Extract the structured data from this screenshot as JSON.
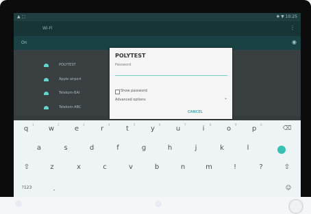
{
  "statusbar": {
    "left": "▲ ⬚",
    "right": "✱ ▼ 10:25"
  },
  "appbar": {
    "title": "Wi‑Fi",
    "more_icon": "⋮"
  },
  "toggle": {
    "label": "On",
    "switch_icon": "◉"
  },
  "networks": [
    {
      "name": "POLYTEST"
    },
    {
      "name": "Apple airport"
    },
    {
      "name": "Telekom-BAI"
    },
    {
      "name": "Telekom-ABC"
    }
  ],
  "dialog": {
    "title": "POLYTEST",
    "password_hint": "Password",
    "show_password": "Show password",
    "advanced": "Advanced options",
    "dropdown_icon": "⌄",
    "cancel": "CANCEL"
  },
  "keyboard": {
    "row1": [
      "q",
      "w",
      "e",
      "r",
      "t",
      "y",
      "u",
      "i",
      "o",
      "p",
      "⌫"
    ],
    "row1_hints": [
      "1",
      "2",
      "3",
      "4",
      "5",
      "6",
      "7",
      "8",
      "9",
      "0"
    ],
    "row2": [
      "a",
      "s",
      "d",
      "f",
      "g",
      "h",
      "j",
      "k",
      "l"
    ],
    "row3": [
      "⇧",
      "z",
      "x",
      "c",
      "v",
      "b",
      "n",
      "m",
      "!",
      "?",
      "⇧"
    ],
    "row4_left": "?123",
    "row4_comma": ",",
    "row4_right": "☺"
  }
}
